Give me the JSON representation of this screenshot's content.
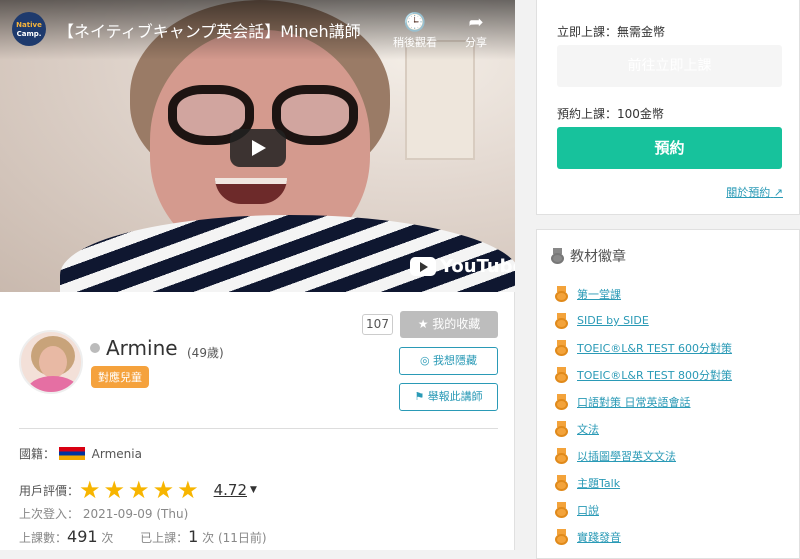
{
  "video": {
    "channel_logo_line1": "Native",
    "channel_logo_line2": "Camp.",
    "title": "【ネイティブキャンプ英会話】Mineh講師",
    "watch_later_label": "稍後觀看",
    "share_label": "分享",
    "youtube_label": "YouTube"
  },
  "tutor": {
    "name": "Armine",
    "age": "(49歲)",
    "kids_badge": "對應兒童",
    "favorite_count": "107",
    "favorite_label": "我的收藏",
    "hide_label": "我想隱藏",
    "report_label": "舉報此講師",
    "country_label": "國籍：",
    "country": "Armenia",
    "rating_label": "用戶評價：",
    "rating_value": "4.72",
    "rating_stars": 5,
    "last_login": "上次登入： 2021-09-09 (Thu)",
    "lessons_label": "上課數：",
    "lessons_count": "491",
    "lessons_unit": "次",
    "taken_label": "已上課：",
    "taken_count": "1",
    "taken_unit": "次 (11日前)"
  },
  "booking": {
    "instant_label": "立即上課：無需金幣",
    "instant_button": "前往立即上課",
    "reserve_label": "預約上課：100金幣",
    "reserve_button": "預約",
    "about_link": "關於預約"
  },
  "badges": {
    "header": "教材徽章",
    "items": [
      "第一堂課",
      "SIDE by SIDE",
      "TOEIC®L&R TEST 600分對策",
      "TOEIC®L&R TEST 800分對策",
      "口語對策 日常英語會話",
      "文法",
      "以插圖學習英文文法",
      "主題Talk",
      "口說",
      "實踐發音"
    ]
  },
  "colors": {
    "accent_green": "#17c29c",
    "link_blue": "#2a9ab6",
    "badge_orange": "#f5a23d",
    "star_gold": "#f7b500"
  }
}
